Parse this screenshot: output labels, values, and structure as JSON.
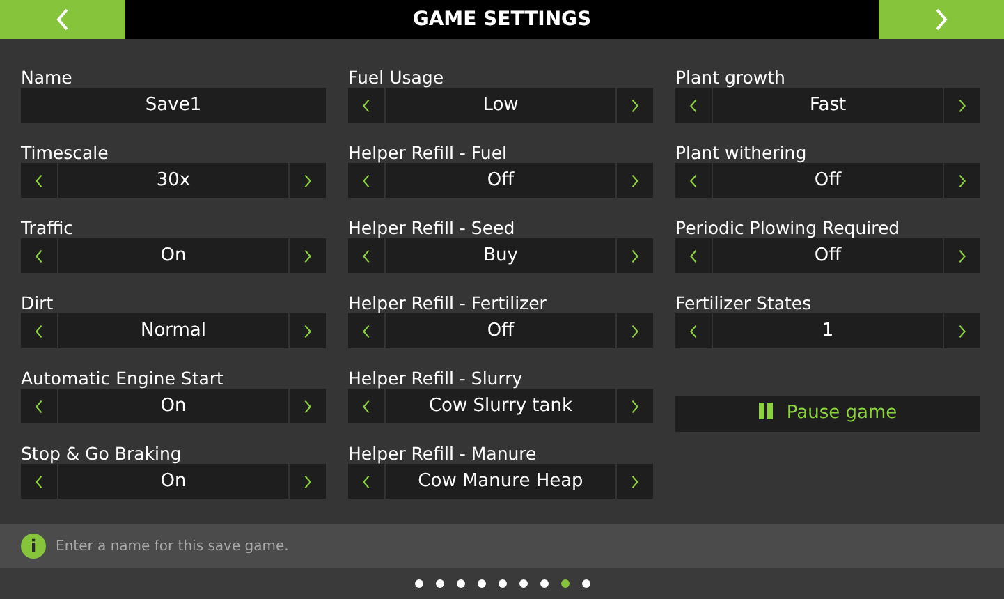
{
  "header": {
    "title": "GAME SETTINGS"
  },
  "columns": [
    [
      {
        "kind": "text",
        "label": "Name",
        "value": "Save1"
      },
      {
        "kind": "selector",
        "label": "Timescale",
        "value": "30x"
      },
      {
        "kind": "selector",
        "label": "Traffic",
        "value": "On"
      },
      {
        "kind": "selector",
        "label": "Dirt",
        "value": "Normal"
      },
      {
        "kind": "selector",
        "label": "Automatic Engine Start",
        "value": "On"
      },
      {
        "kind": "selector",
        "label": "Stop & Go Braking",
        "value": "On"
      }
    ],
    [
      {
        "kind": "selector",
        "label": "Fuel Usage",
        "value": "Low"
      },
      {
        "kind": "selector",
        "label": "Helper Refill - Fuel",
        "value": "Off"
      },
      {
        "kind": "selector",
        "label": "Helper Refill - Seed",
        "value": "Buy"
      },
      {
        "kind": "selector",
        "label": "Helper Refill - Fertilizer",
        "value": "Off"
      },
      {
        "kind": "selector",
        "label": "Helper Refill - Slurry",
        "value": "Cow Slurry tank"
      },
      {
        "kind": "selector",
        "label": "Helper Refill - Manure",
        "value": "Cow Manure Heap"
      }
    ],
    [
      {
        "kind": "selector",
        "label": "Plant growth",
        "value": "Fast"
      },
      {
        "kind": "selector",
        "label": "Plant withering",
        "value": "Off"
      },
      {
        "kind": "selector",
        "label": "Periodic Plowing Required",
        "value": "Off"
      },
      {
        "kind": "selector",
        "label": "Fertilizer States",
        "value": "1"
      },
      {
        "kind": "action",
        "value": "Pause game"
      }
    ]
  ],
  "info": {
    "icon": "i",
    "text": "Enter a name for this save game."
  },
  "pages": [
    {
      "selected": false
    },
    {
      "selected": false
    },
    {
      "selected": false
    },
    {
      "selected": false
    },
    {
      "selected": false
    },
    {
      "selected": false
    },
    {
      "selected": false
    },
    {
      "selected": true
    },
    {
      "selected": false
    }
  ]
}
